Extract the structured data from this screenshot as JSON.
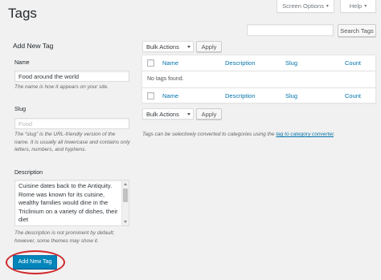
{
  "header": {
    "title": "Tags",
    "screen_options": "Screen Options",
    "help": "Help"
  },
  "search": {
    "button": "Search Tags",
    "value": ""
  },
  "form": {
    "title": "Add New Tag",
    "name": {
      "label": "Name",
      "value": "Food around the world",
      "description": "The name is how it appears on your site."
    },
    "slug": {
      "label": "Slug",
      "value": "Food",
      "description": "The “slug” is the URL-friendly version of the name. It is usually all lowercase and contains only letters, numbers, and hyphens."
    },
    "description_field": {
      "label": "Description",
      "value": "Cuisine dates back to the Antiquity. Rome was known for its cuisine, wealthy families would dine in the Triclinium on a variety of dishes, their diet",
      "description": "The description is not prominent by default; however, some themes may show it."
    },
    "submit": "Add New Tag"
  },
  "list": {
    "bulk_actions": "Bulk Actions",
    "apply": "Apply",
    "columns": [
      "Name",
      "Description",
      "Slug",
      "Count"
    ],
    "empty_message": "No tags found.",
    "convert_note_prefix": "Tags can be selectively converted to categories using the ",
    "convert_link": "tag to category converter",
    "convert_note_suffix": "."
  },
  "colors": {
    "primary_button": "#0085ba",
    "link": "#0073aa",
    "highlight_ring": "#d0272b",
    "background": "#f1f1f1"
  }
}
